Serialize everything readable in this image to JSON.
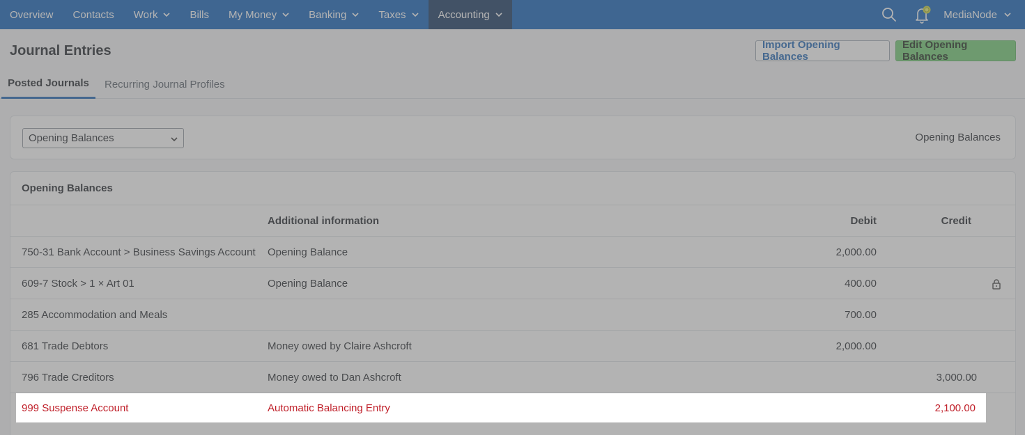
{
  "nav": {
    "items": [
      {
        "label": "Overview",
        "dropdown": false
      },
      {
        "label": "Contacts",
        "dropdown": false
      },
      {
        "label": "Work",
        "dropdown": true
      },
      {
        "label": "Bills",
        "dropdown": false
      },
      {
        "label": "My Money",
        "dropdown": true
      },
      {
        "label": "Banking",
        "dropdown": true
      },
      {
        "label": "Taxes",
        "dropdown": true
      },
      {
        "label": "Accounting",
        "dropdown": true,
        "active": true
      }
    ],
    "user": "MediaNode",
    "search_icon": "search-icon",
    "bell_icon": "notification-bell-icon"
  },
  "header": {
    "title": "Journal Entries",
    "import_button": "Import Opening Balances",
    "edit_button": "Edit Opening Balances"
  },
  "tabs": {
    "posted": "Posted Journals",
    "recurring": "Recurring Journal Profiles"
  },
  "filter": {
    "selected": "Opening Balances",
    "label": "Opening Balances"
  },
  "table": {
    "title": "Opening Balances",
    "headers": {
      "account": "",
      "info": "Additional information",
      "debit": "Debit",
      "credit": "Credit"
    },
    "rows": [
      {
        "account": "750-31 Bank Account > Business Savings Account",
        "info": "Opening Balance",
        "debit": "2,000.00",
        "credit": ""
      },
      {
        "account": "609-7 Stock > 1 × Art 01",
        "info": "Opening Balance",
        "debit": "400.00",
        "credit": "",
        "locked": true
      },
      {
        "account": "285 Accommodation and Meals",
        "info": "",
        "debit": "700.00",
        "credit": ""
      },
      {
        "account": "681 Trade Debtors",
        "info": "Money owed by Claire Ashcroft",
        "debit": "2,000.00",
        "credit": ""
      },
      {
        "account": "796 Trade Creditors",
        "info": "Money owed to Dan Ashcroft",
        "debit": "",
        "credit": "3,000.00"
      },
      {
        "account": "999 Suspense Account",
        "info": "Automatic Balancing Entry",
        "debit": "",
        "credit": "2,100.00",
        "highlighted": true
      }
    ]
  },
  "colors": {
    "nav_bg": "#0e5fb8",
    "nav_active": "#14355f",
    "primary_blue": "#1b63b5",
    "green_button": "#6fcb72",
    "suspense_red": "#c0202a"
  }
}
